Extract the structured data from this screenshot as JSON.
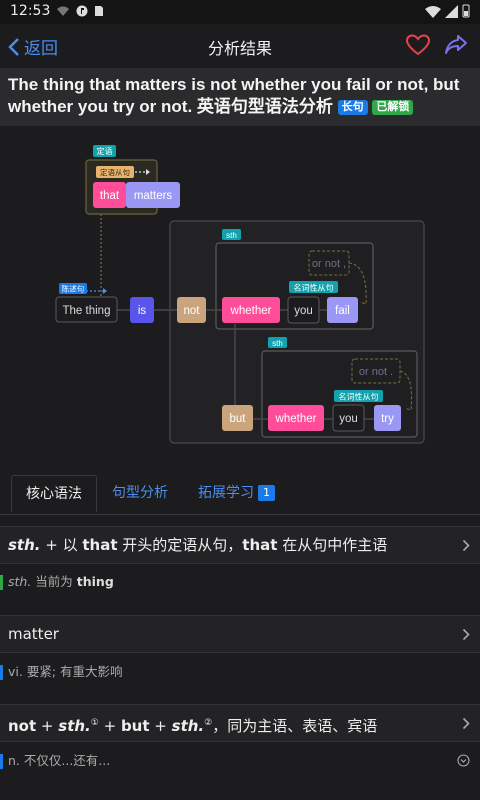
{
  "status_bar": {
    "time": "12:53"
  },
  "nav": {
    "back_label": "返回",
    "title": "分析结果"
  },
  "sentence": {
    "text": "The thing that matters is not whether you fail or not, but whether you try or not. 英语句型语法分析",
    "tag_long": "长句",
    "tag_unlocked": "已解锁"
  },
  "diagram": {
    "tag_attributive": "定语",
    "tag_attr_clause": "定语从句",
    "tag_declarative": "陈述句",
    "tag_sth1": "sth",
    "tag_sth2": "sth",
    "tag_noun_clause1": "名词性从句",
    "tag_noun_clause2": "名词性从句",
    "that": "that",
    "matters": "matters",
    "the_thing": "The thing",
    "is": "is",
    "not": "not",
    "whether1": "whether",
    "you1": "you",
    "fail": "fail",
    "or_not1": "or not ,",
    "but": "but",
    "whether2": "whether",
    "you2": "you",
    "try": "try",
    "or_not2": "or not ."
  },
  "tabs": {
    "core": "核心语法",
    "pattern": "句型分析",
    "extend": "拓展学习",
    "extend_badge": "1"
  },
  "grammar": [
    {
      "head_sth": "sth.",
      "head_plus": " + 以 ",
      "head_that1": "that",
      "head_mid": " 开头的定语从句，",
      "head_that2": "that",
      "head_end": " 在从句中作主语",
      "sub_sth": "sth.",
      "sub_mid": " 当前为 ",
      "sub_val": "thing"
    },
    {
      "head": "matter",
      "sub": "vi. 要紧; 有重大影响"
    },
    {
      "h_not": "not",
      "h_p1": " + ",
      "h_sth1": "sth.",
      "h_s1": "①",
      "h_p2": " + ",
      "h_but": "but",
      "h_p3": " + ",
      "h_sth2": "sth.",
      "h_s2": "②",
      "h_end": "，同为主语、表语、宾语",
      "sub": "n. 不仅仅...还有..."
    }
  ],
  "colors": {
    "accent": "#4a8ef0",
    "pink": "#ff4d9a",
    "lavender": "#9a97f5",
    "indigo": "#5a55ea",
    "tan": "#c9a47c",
    "teal": "#12a2ad",
    "green_bar": "#2fa84a",
    "blue_bar": "#1a7ae8"
  }
}
